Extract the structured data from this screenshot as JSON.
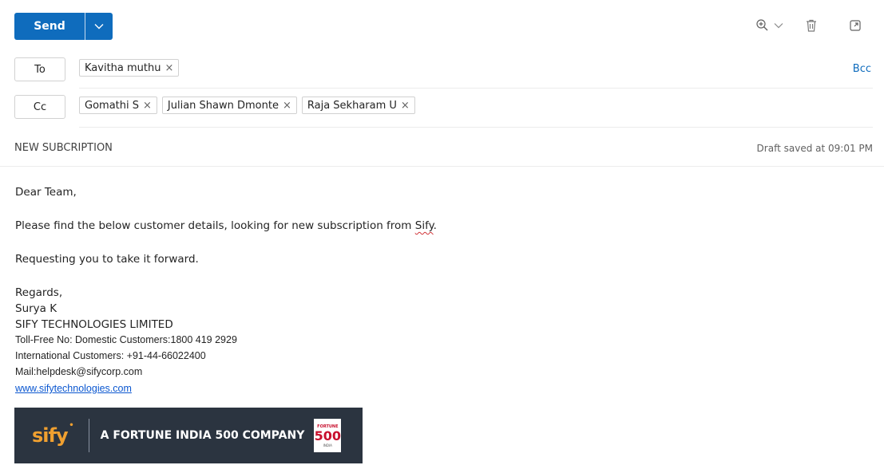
{
  "toolbar": {
    "send_label": "Send",
    "icons": [
      "zoom-icon",
      "chevron-down-icon",
      "delete-icon",
      "popout-icon"
    ]
  },
  "recipients": {
    "to_label": "To",
    "cc_label": "Cc",
    "bcc_label": "Bcc",
    "to": [
      {
        "name": "Kavitha muthu"
      }
    ],
    "cc": [
      {
        "name": "Gomathi S"
      },
      {
        "name": "Julian Shawn Dmonte"
      },
      {
        "name": "Raja Sekharam U"
      }
    ],
    "remove_glyph": "×"
  },
  "subject": "NEW SUBCRIPTION",
  "draft_status": "Draft saved at 09:01 PM",
  "body": {
    "greeting": "Dear Team,",
    "line1_before": "Please find the below customer details, looking for new subscription from ",
    "line1_flagged": "Sify",
    "line1_after": ".",
    "line2": "Requesting you to take it forward.",
    "closing": "Regards,",
    "signature": {
      "name": "Surya K",
      "company": "SIFY TECHNOLOGIES LIMITED",
      "tollfree": "Toll-Free No: Domestic Customers:1800 419 2929",
      "international": "International Customers: +91-44-66022400",
      "mail": "Mail:helpdesk@sifycorp.com",
      "website": "www.sifytechnologies.com"
    }
  },
  "banner": {
    "logo": "sify",
    "logo_mark": "•",
    "tagline": "A FORTUNE INDIA 500 COMPANY",
    "badge_top": "FORTUNE",
    "badge_number": "500",
    "badge_bottom": "INDIA"
  },
  "colors": {
    "accent": "#0f6cbd",
    "banner_bg": "#2b3440",
    "logo_orange": "#f0a030",
    "link": "#0b57d0"
  }
}
